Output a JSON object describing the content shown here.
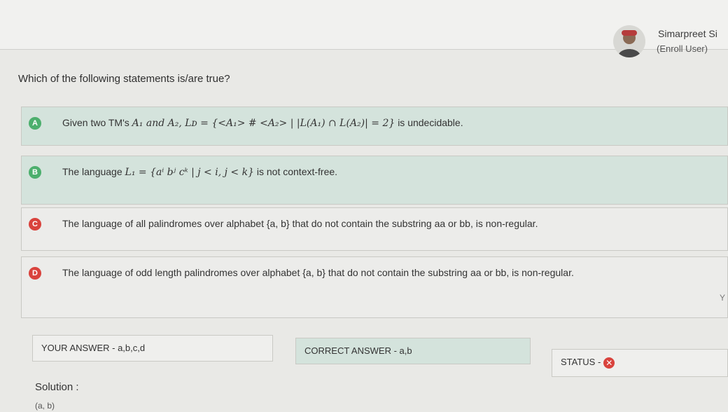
{
  "user": {
    "name": "Simarpreet Si",
    "role": "(Enroll User)"
  },
  "question": "Which of the following statements is/are true?",
  "options": [
    {
      "letter": "A",
      "pre": "Given two TM's",
      "math": "A₁ and A₂, Lᴅ = {<A₁> # <A₂> | |L(A₁) ∩ L(A₂)| = 2}",
      "post": "is undecidable."
    },
    {
      "letter": "B",
      "pre": "The language",
      "math": "L₁ = {aⁱ bʲ cᵏ | j < i, j < k}",
      "post": "is not context-free."
    },
    {
      "letter": "C",
      "pre": "The language of all palindromes over alphabet {a, b} that do not contain the substring aa or bb, is non-regular.",
      "math": "",
      "post": ""
    },
    {
      "letter": "D",
      "pre": "The language of odd length palindromes over alphabet {a, b} that do not contain the substring aa or bb, is non-regular.",
      "math": "",
      "post": ""
    }
  ],
  "answers": {
    "your": "YOUR ANSWER - a,b,c,d",
    "correct": "CORRECT ANSWER - a,b",
    "status": "STATUS -",
    "status_icon": "x-icon"
  },
  "side_letter": "Y",
  "solution": {
    "label": "Solution :",
    "value": "(a, b)"
  },
  "colors": {
    "correct_green": "#4caf6d",
    "wrong_red": "#d9433d",
    "highlight": "#d4e3dc"
  }
}
